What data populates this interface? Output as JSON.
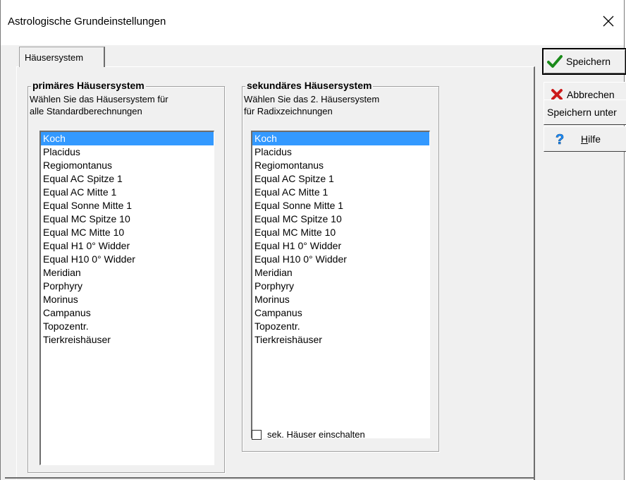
{
  "window": {
    "title": "Astrologische Grundeinstellungen"
  },
  "tabs": [
    {
      "label": "Häusersystem"
    }
  ],
  "primary": {
    "title": "primäres Häusersystem",
    "description": "Wählen Sie das Häusersystem für\nalle Standardberechnungen",
    "selected": "Koch",
    "items": [
      "Koch",
      "Placidus",
      "Regiomontanus",
      "Equal AC Spitze 1",
      "Equal AC Mitte 1",
      "Equal Sonne Mitte 1",
      "Equal MC Spitze 10",
      "Equal MC Mitte 10",
      "Equal H1 0° Widder",
      "Equal H10 0° Widder",
      "Meridian",
      "Porphyry",
      "Morinus",
      "Campanus",
      "Topozentr.",
      "Tierkreishäuser"
    ]
  },
  "secondary": {
    "title": "sekundäres Häusersystem",
    "description": "Wählen Sie das 2. Häusersystem\nfür Radixzeichnungen",
    "selected": "Koch",
    "items": [
      "Koch",
      "Placidus",
      "Regiomontanus",
      "Equal AC Spitze 1",
      "Equal AC Mitte 1",
      "Equal Sonne Mitte 1",
      "Equal MC Spitze 10",
      "Equal MC Mitte 10",
      "Equal H1 0° Widder",
      "Equal H10 0° Widder",
      "Meridian",
      "Porphyry",
      "Morinus",
      "Campanus",
      "Topozentr.",
      "Tierkreishäuser"
    ],
    "checkbox_label": "sek. Häuser einschalten",
    "checkbox_checked": false
  },
  "buttons": {
    "save": "Speichern",
    "cancel": "Abbrechen",
    "save_as": "Speichern unter",
    "help": "Hilfe"
  },
  "icons": {
    "close": "close-icon",
    "save": "checkmark-icon",
    "cancel": "red-x-icon",
    "help": "question-mark-icon"
  },
  "colors": {
    "selection": "#3399ff",
    "checkmark": "#1a8a1a",
    "cancel_x": "#cc1a1a",
    "help_q": "#1e90ff"
  }
}
